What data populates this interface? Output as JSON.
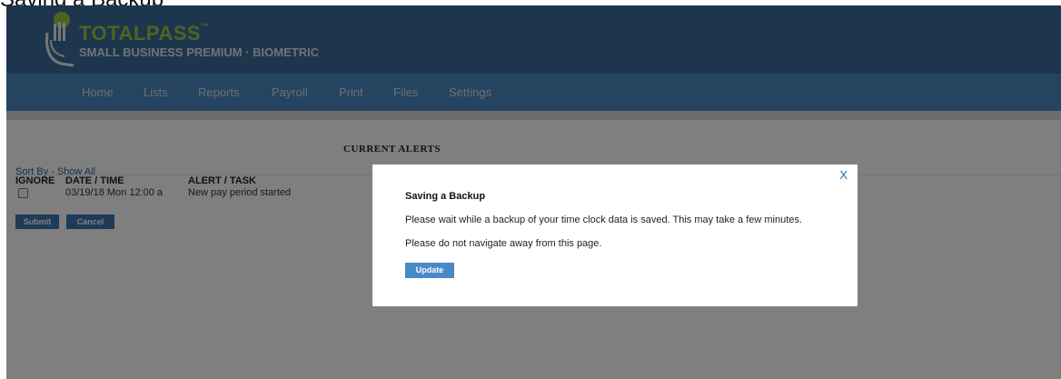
{
  "page_caption": "Saving a Backup",
  "header": {
    "logo_title": "TOTALPASS",
    "logo_tm": "™",
    "logo_subtitle": "SMALL BUSINESS PREMIUM · BIOMETRIC"
  },
  "nav": {
    "items": [
      {
        "label": "Home"
      },
      {
        "label": "Lists"
      },
      {
        "label": "Reports"
      },
      {
        "label": "Payroll"
      },
      {
        "label": "Print"
      },
      {
        "label": "Files"
      },
      {
        "label": "Settings"
      }
    ]
  },
  "alerts": {
    "title": "CURRENT ALERTS",
    "sort_by": "Sort By - Show All",
    "columns": {
      "ignore": "IGNORE",
      "datetime": "DATE / TIME",
      "alert": "ALERT / TASK"
    },
    "rows": [
      {
        "ignore_checked": false,
        "datetime": "03/19/18 Mon 12:00 a",
        "alert": "New pay period started"
      }
    ],
    "submit_label": "Submit",
    "cancel_label": "Cancel"
  },
  "modal": {
    "close_label": "X",
    "title": "Saving a Backup",
    "message1": "Please wait while a backup of your time clock data is saved. This may take a few minutes.",
    "message2": "Please do not navigate away from this page.",
    "update_label": "Update"
  },
  "colors": {
    "header": "#3c6d9b",
    "nav": "#4a89bf",
    "logo_green": "#9cc641",
    "button": "#3d79b3",
    "modal_button": "#4a89c8"
  },
  "icons": {
    "logo": "hand-fingerprint-icon",
    "close": "close-icon",
    "checkbox": "checkbox"
  }
}
